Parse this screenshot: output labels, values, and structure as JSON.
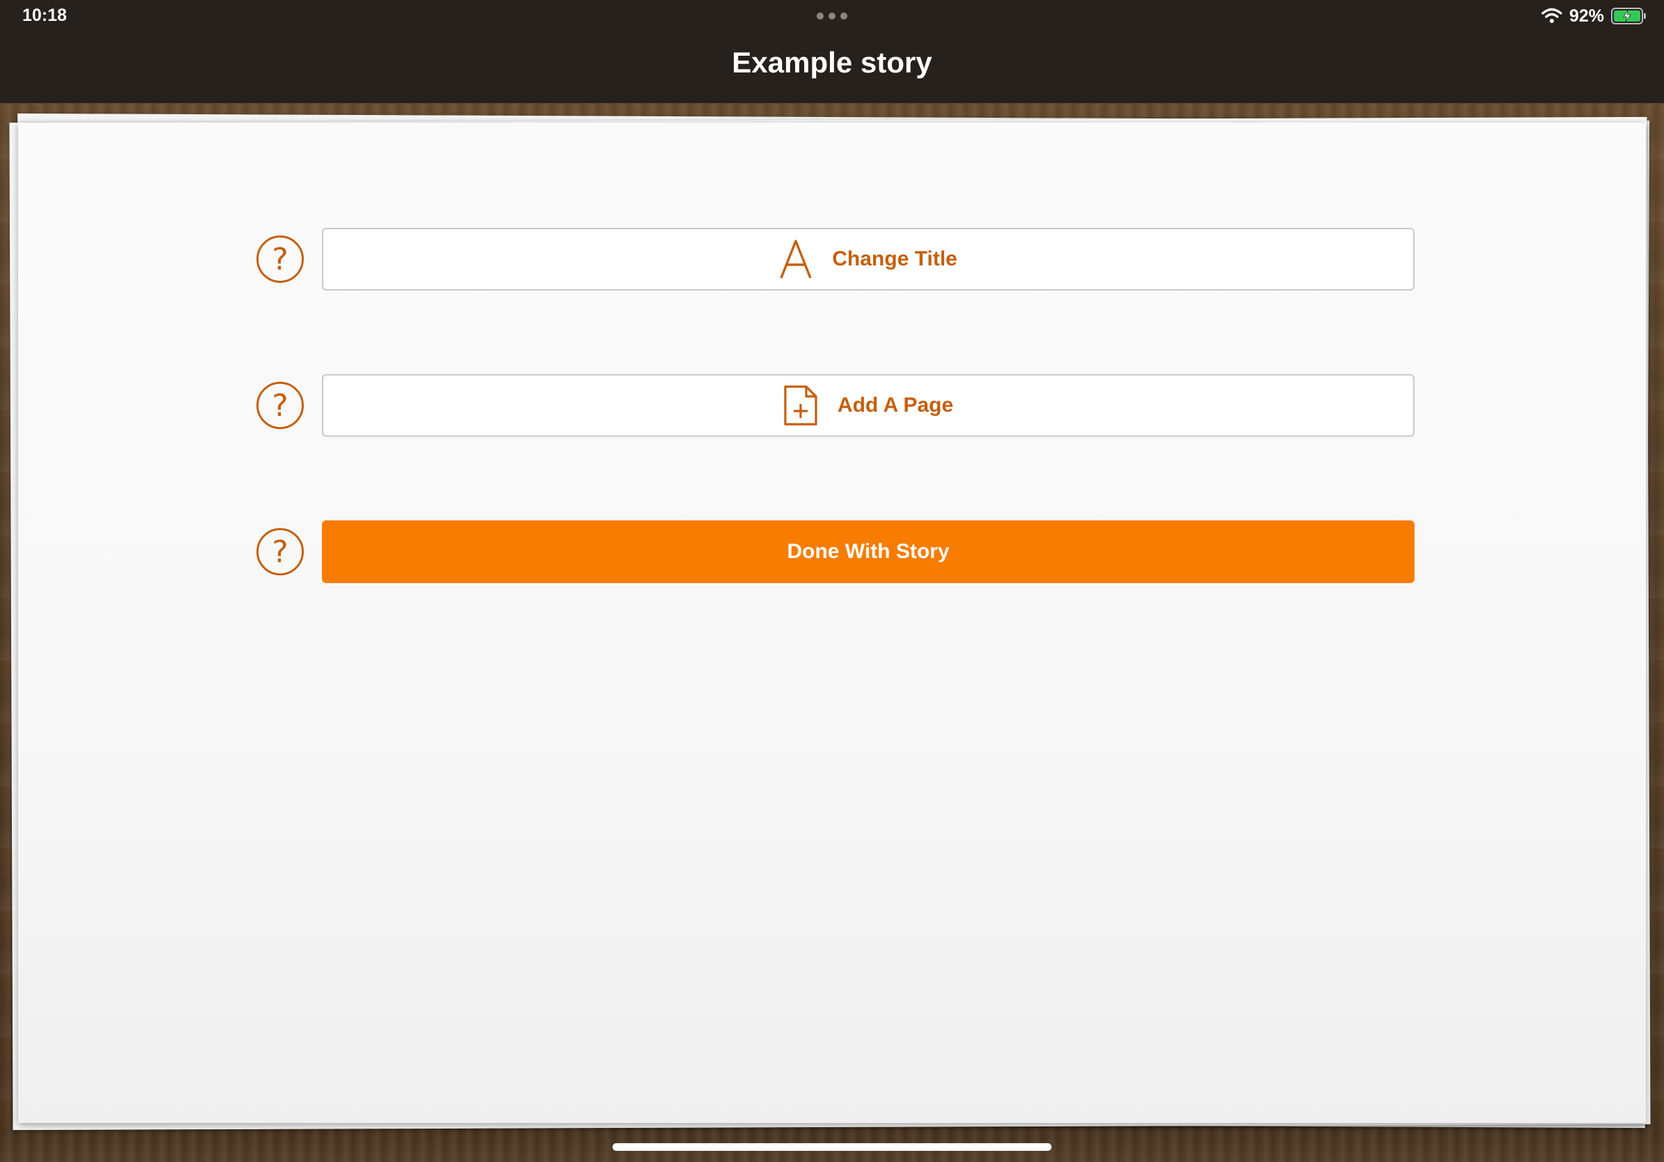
{
  "status_bar": {
    "time": "10:18",
    "battery_percent": "92%",
    "battery_level": 0.92,
    "icons": [
      "more-dots-icon",
      "wifi-icon",
      "battery-charging-icon"
    ]
  },
  "nav": {
    "title": "Example story"
  },
  "actions": [
    {
      "label": "Change Title",
      "icon": "letter-a-icon",
      "style": "outline"
    },
    {
      "label": "Add A Page",
      "icon": "document-add-icon",
      "style": "outline"
    },
    {
      "label": "Done With Story",
      "icon": "",
      "style": "primary"
    }
  ],
  "help_glyph": "?",
  "colors": {
    "accent": "#c55f0c",
    "primary_button": "#f77c00",
    "top_bar": "#26211d",
    "paper": "#fafafa",
    "wood": "#5b4229"
  }
}
